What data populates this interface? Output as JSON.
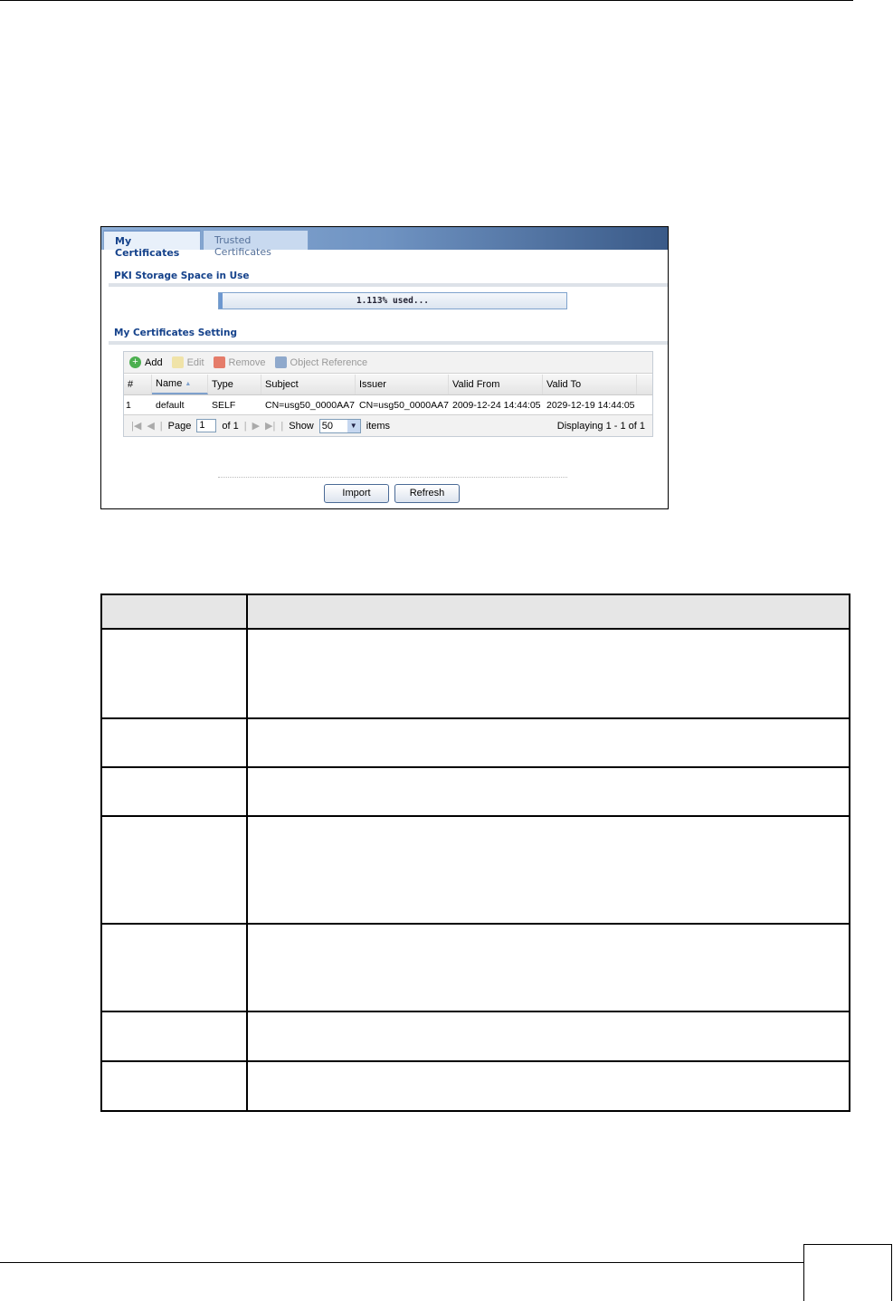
{
  "tabs": [
    {
      "label": "My Certificates",
      "active": true
    },
    {
      "label": "Trusted Certificates",
      "active": false
    }
  ],
  "storage": {
    "heading": "PKI Storage Space in Use",
    "progress_text": "1.113% used...",
    "used_percent": 1.113
  },
  "settings": {
    "heading": "My Certificates Setting"
  },
  "toolbar": {
    "add": "Add",
    "edit": "Edit",
    "remove": "Remove",
    "object_reference": "Object Reference"
  },
  "grid": {
    "columns": [
      "#",
      "Name",
      "Type",
      "Subject",
      "Issuer",
      "Valid From",
      "Valid To"
    ],
    "sort_indicator": "▲",
    "rows": [
      [
        "1",
        "default",
        "SELF",
        "CN=usg50_0000AA7",
        "CN=usg50_0000AA7",
        "2009-12-24 14:44:05",
        "2029-12-19 14:44:05"
      ]
    ]
  },
  "pager": {
    "page_label": "Page",
    "page_value": "1",
    "of_label": "of 1",
    "show_label": "Show",
    "show_value": "50",
    "items_label": "items",
    "displaying": "Displaying 1 - 1 of 1"
  },
  "buttons": {
    "import": "Import",
    "refresh": "Refresh"
  }
}
